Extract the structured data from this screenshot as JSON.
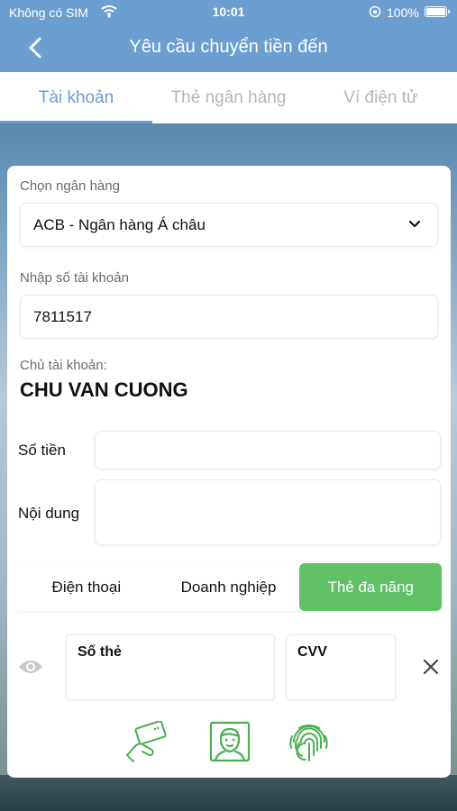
{
  "status_bar": {
    "carrier": "Không có SIM",
    "time": "10:01",
    "battery": "100%"
  },
  "header": {
    "title": "Yêu cầu chuyển tiền đến",
    "back_icon": "chevron-left-icon"
  },
  "tabs": [
    {
      "label": "Tài khoản",
      "active": true
    },
    {
      "label": "Thẻ ngân hàng",
      "active": false
    },
    {
      "label": "Ví điện tử",
      "active": false
    }
  ],
  "form": {
    "bank": {
      "label": "Chọn ngân hàng",
      "value": "ACB - Ngân hàng Á châu"
    },
    "account_number": {
      "label": "Nhập số tài khoản",
      "value": "7811517"
    },
    "account_owner": {
      "label": "Chủ tài khoản:",
      "value": "CHU VAN CUONG"
    },
    "amount": {
      "label": "Số tiền",
      "value": ""
    },
    "content": {
      "label": "Nội dung",
      "value": ""
    }
  },
  "auth_methods": [
    {
      "label": "Điện thoại",
      "active": false
    },
    {
      "label": "Doanh nghiệp",
      "active": false
    },
    {
      "label": "Thẻ đa năng",
      "active": true
    }
  ],
  "card_inputs": {
    "card_number_label": "Số thẻ",
    "cvv_label": "CVV"
  },
  "colors": {
    "primary": "#6d9ed0",
    "accent_green": "#61c167",
    "icon_green": "#4caf50"
  },
  "icons": [
    "eye-icon",
    "close-icon",
    "card-payment-icon",
    "face-id-icon",
    "fingerprint-icon"
  ]
}
